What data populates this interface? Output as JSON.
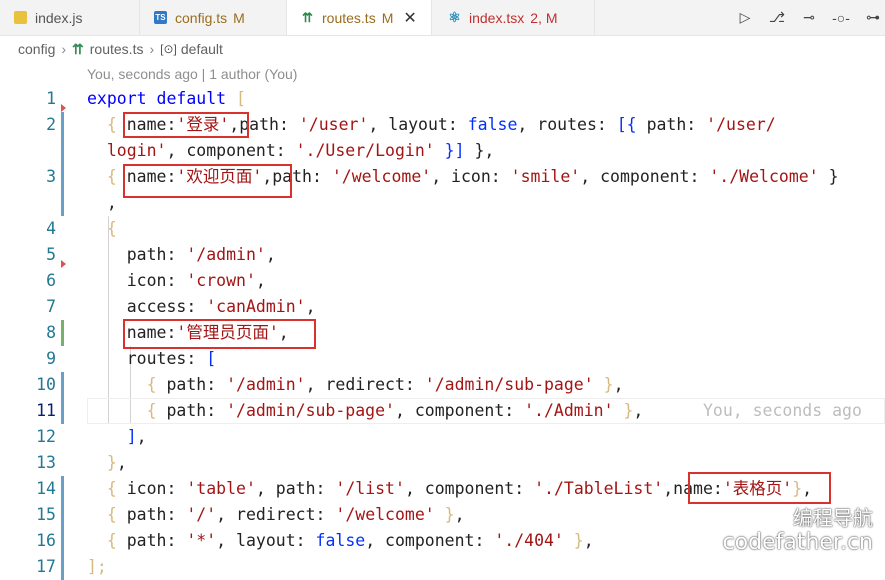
{
  "tabs": [
    {
      "name": "index.js",
      "flag": "",
      "icon": "js-file-icon",
      "active": false
    },
    {
      "name": "config.ts",
      "flag": "M",
      "icon": "ts-file-icon",
      "active": false
    },
    {
      "name": "routes.ts",
      "flag": "M",
      "icon": "routes-file-icon",
      "active": true
    },
    {
      "name": "index.tsx",
      "flag": "2, M",
      "icon": "react-file-icon",
      "active": false
    }
  ],
  "breadcrumb": {
    "folder": "config",
    "file": "routes.ts",
    "symbol": "default"
  },
  "blame": "You, seconds ago | 1 author (You)",
  "lines": [
    {
      "n": "1",
      "parts": [
        [
          "k",
          "export default "
        ],
        [
          "y",
          "["
        ]
      ]
    },
    {
      "n": "2",
      "parts": [
        [
          "y",
          "  { "
        ],
        [
          "p",
          "name:"
        ],
        [
          "s",
          "'登录'"
        ],
        [
          "p",
          ",path: "
        ],
        [
          "s",
          "'/user'"
        ],
        [
          "p",
          ", layout: "
        ],
        [
          "b",
          "false"
        ],
        [
          "p",
          ", routes: "
        ],
        [
          "b",
          "[{ "
        ],
        [
          "p",
          "path: "
        ],
        [
          "s",
          "'/user/"
        ]
      ]
    },
    {
      "n": "",
      "parts": [
        [
          "s",
          "  login'"
        ],
        [
          "p",
          ", component: "
        ],
        [
          "s",
          "'./User/Login'"
        ],
        [
          "p",
          " "
        ],
        [
          "b",
          "}]"
        ],
        [
          "p",
          " },"
        ]
      ]
    },
    {
      "n": "3",
      "parts": [
        [
          "y",
          "  { "
        ],
        [
          "p",
          "name:"
        ],
        [
          "s",
          "'欢迎页面'"
        ],
        [
          "p",
          ",path: "
        ],
        [
          "s",
          "'/welcome'"
        ],
        [
          "p",
          ", icon: "
        ],
        [
          "s",
          "'smile'"
        ],
        [
          "p",
          ", component: "
        ],
        [
          "s",
          "'./Welcome'"
        ],
        [
          "p",
          " }"
        ]
      ]
    },
    {
      "n": "",
      "parts": [
        [
          "p",
          "  ,"
        ]
      ]
    },
    {
      "n": "4",
      "parts": [
        [
          "y",
          "  {"
        ]
      ]
    },
    {
      "n": "5",
      "parts": [
        [
          "p",
          "    path: "
        ],
        [
          "s",
          "'/admin'"
        ],
        [
          "p",
          ","
        ]
      ]
    },
    {
      "n": "6",
      "parts": [
        [
          "p",
          "    icon: "
        ],
        [
          "s",
          "'crown'"
        ],
        [
          "p",
          ","
        ]
      ]
    },
    {
      "n": "7",
      "parts": [
        [
          "p",
          "    access: "
        ],
        [
          "s",
          "'canAdmin'"
        ],
        [
          "p",
          ","
        ]
      ]
    },
    {
      "n": "8",
      "parts": [
        [
          "p",
          "    name:"
        ],
        [
          "s",
          "'管理员页面'"
        ],
        [
          "p",
          ","
        ]
      ]
    },
    {
      "n": "9",
      "parts": [
        [
          "p",
          "    routes: "
        ],
        [
          "b",
          "["
        ]
      ]
    },
    {
      "n": "10",
      "parts": [
        [
          "y",
          "      { "
        ],
        [
          "p",
          "path: "
        ],
        [
          "s",
          "'/admin'"
        ],
        [
          "p",
          ", redirect: "
        ],
        [
          "s",
          "'/admin/sub-page'"
        ],
        [
          "y",
          " }"
        ],
        [
          "p",
          ","
        ]
      ]
    },
    {
      "n": "11",
      "parts": [
        [
          "y",
          "      { "
        ],
        [
          "p",
          "path: "
        ],
        [
          "s",
          "'/admin/sub-page'"
        ],
        [
          "p",
          ", component: "
        ],
        [
          "s",
          "'./Admin'"
        ],
        [
          "y",
          " }"
        ],
        [
          "p",
          ","
        ]
      ]
    },
    {
      "n": "12",
      "parts": [
        [
          "b",
          "    ]"
        ],
        [
          "p",
          ","
        ]
      ]
    },
    {
      "n": "13",
      "parts": [
        [
          "y",
          "  }"
        ],
        [
          "p",
          ","
        ]
      ]
    },
    {
      "n": "14",
      "parts": [
        [
          "y",
          "  { "
        ],
        [
          "p",
          "icon: "
        ],
        [
          "s",
          "'table'"
        ],
        [
          "p",
          ", path: "
        ],
        [
          "s",
          "'/list'"
        ],
        [
          "p",
          ", component: "
        ],
        [
          "s",
          "'./TableList'"
        ],
        [
          "p",
          ",name:"
        ],
        [
          "s",
          "'表格页'"
        ],
        [
          "y",
          "}"
        ],
        [
          "p",
          ","
        ]
      ]
    },
    {
      "n": "15",
      "parts": [
        [
          "y",
          "  { "
        ],
        [
          "p",
          "path: "
        ],
        [
          "s",
          "'/'"
        ],
        [
          "p",
          ", redirect: "
        ],
        [
          "s",
          "'/welcome'"
        ],
        [
          "y",
          " }"
        ],
        [
          "p",
          ","
        ]
      ]
    },
    {
      "n": "16",
      "parts": [
        [
          "y",
          "  { "
        ],
        [
          "p",
          "path: "
        ],
        [
          "s",
          "'*'"
        ],
        [
          "p",
          ", layout: "
        ],
        [
          "b",
          "false"
        ],
        [
          "p",
          ", component: "
        ],
        [
          "s",
          "'./404'"
        ],
        [
          "y",
          " }"
        ],
        [
          "p",
          ","
        ]
      ]
    },
    {
      "n": "17",
      "parts": [
        [
          "y",
          "];"
        ]
      ]
    }
  ],
  "inline_blame": "You, seconds ago",
  "watermark": {
    "line1": "编程导航",
    "line2": "codefather.cn"
  }
}
